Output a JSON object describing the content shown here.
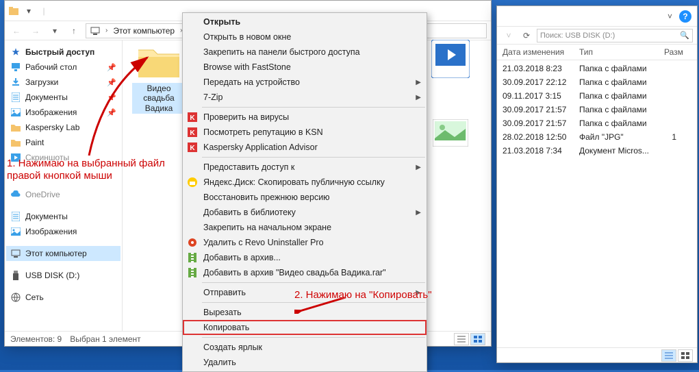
{
  "left_window": {
    "breadcrumb_root": "Этот компьютер",
    "search_placeholder": "",
    "sidebar": [
      {
        "icon": "star",
        "label": "Быстрый доступ",
        "bold": true
      },
      {
        "icon": "desktop",
        "label": "Рабочий стол",
        "pin": true
      },
      {
        "icon": "download",
        "label": "Загрузки",
        "pin": true
      },
      {
        "icon": "doc",
        "label": "Документы",
        "pin": true
      },
      {
        "icon": "image",
        "label": "Изображения",
        "pin": true
      },
      {
        "icon": "folder-y",
        "label": "Kaspersky Lab"
      },
      {
        "icon": "folder-y",
        "label": "Paint"
      },
      {
        "icon": "video",
        "label": "Скриншоты",
        "dim": true
      },
      {
        "icon": "",
        "label": "",
        "dim": true
      },
      {
        "icon": "cloud",
        "label": "OneDrive",
        "dim": true
      },
      {
        "icon": "doc",
        "label": "Документы"
      },
      {
        "icon": "image",
        "label": "Изображения"
      },
      {
        "icon": "pc",
        "label": "Этот компьютер",
        "sel": true
      },
      {
        "icon": "usb",
        "label": "USB DISK (D:)"
      },
      {
        "icon": "net",
        "label": "Сеть"
      }
    ],
    "folder_label": "Видео свадьба Вадика",
    "status_items": "Элементов: 9",
    "status_sel": "Выбран 1 элемент"
  },
  "right_window": {
    "search_placeholder": "Поиск: USB DISK (D:)",
    "columns": [
      "Дата изменения",
      "Тип",
      "Разм"
    ],
    "rows": [
      {
        "date": "21.03.2018 8:23",
        "type": "Папка с файлами",
        "size": ""
      },
      {
        "date": "30.09.2017 22:12",
        "type": "Папка с файлами",
        "size": ""
      },
      {
        "date": "09.11.2017 3:15",
        "type": "Папка с файлами",
        "size": ""
      },
      {
        "date": "30.09.2017 21:57",
        "type": "Папка с файлами",
        "size": ""
      },
      {
        "date": "30.09.2017 21:57",
        "type": "Папка с файлами",
        "size": ""
      },
      {
        "date": "28.02.2018 12:50",
        "type": "Файл \"JPG\"",
        "size": "1"
      },
      {
        "date": "21.03.2018 7:34",
        "type": "Документ Micros...",
        "size": ""
      }
    ]
  },
  "context_menu": [
    {
      "label": "Открыть",
      "bold": true
    },
    {
      "label": "Открыть в новом окне"
    },
    {
      "label": "Закрепить на панели быстрого доступа"
    },
    {
      "label": "Browse with FastStone"
    },
    {
      "label": "Передать на устройство",
      "arrow": true
    },
    {
      "label": "7-Zip",
      "arrow": true,
      "sep_after": true
    },
    {
      "label": "Проверить на вирусы",
      "icon": "k-red"
    },
    {
      "label": "Посмотреть репутацию в KSN",
      "icon": "k-red"
    },
    {
      "label": "Kaspersky Application Advisor",
      "icon": "k-red",
      "sep_after": true
    },
    {
      "label": "Предоставить доступ к",
      "arrow": true
    },
    {
      "label": "Яндекс.Диск: Скопировать публичную ссылку",
      "icon": "yd"
    },
    {
      "label": "Восстановить прежнюю версию"
    },
    {
      "label": "Добавить в библиотеку",
      "arrow": true
    },
    {
      "label": "Закрепить на начальном экране"
    },
    {
      "label": "Удалить с Revo Uninstaller Pro",
      "icon": "revo"
    },
    {
      "label": "Добавить в архив...",
      "icon": "rar"
    },
    {
      "label": "Добавить в архив \"Видео свадьба Вадика.rar\"",
      "icon": "rar",
      "sep_after": true
    },
    {
      "label": "Отправить",
      "arrow": true,
      "sep_after": true
    },
    {
      "label": "Вырезать"
    },
    {
      "label": "Копировать",
      "highlight": true,
      "sep_after": true
    },
    {
      "label": "Создать ярлык"
    },
    {
      "label": "Удалить"
    }
  ],
  "annotations": {
    "a1": "1. Нажимаю на выбранный файл правой кнопкой мыши",
    "a2": "2. Нажимаю на \"Копировать\""
  }
}
